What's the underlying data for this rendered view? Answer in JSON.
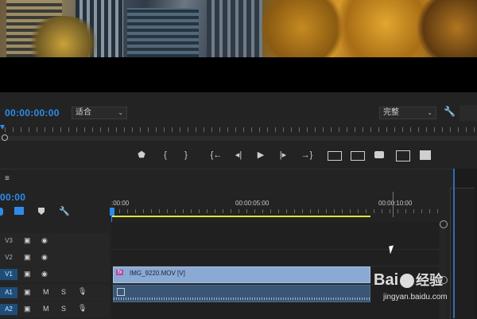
{
  "program_monitor": {
    "timecode": "00:00:00:00",
    "zoom_select": "适合",
    "quality_select": "完整"
  },
  "controls": {
    "marker": "⬟",
    "in_point": "{",
    "out_point": "}",
    "go_in": "{←",
    "step_back": "◂|",
    "play": "▶",
    "step_fwd": "|▸",
    "go_out": "→}"
  },
  "timeline": {
    "menu": "≡",
    "timecode": "00:00",
    "ruler_labels": [
      ":00:00",
      "00:00:05:00",
      "00:00:10:00"
    ],
    "tracks": [
      {
        "name": "V3",
        "active": false
      },
      {
        "name": "V2",
        "active": false
      },
      {
        "name": "V1",
        "active": true
      },
      {
        "name": "A1",
        "active": true
      },
      {
        "name": "A2",
        "active": true
      }
    ],
    "clip_video_label": "IMG_9220.MOV [V]",
    "fx_badge": "fx",
    "audio_m": "M",
    "audio_s": "S"
  },
  "watermark": {
    "brand": "Bai",
    "brand2": "经验",
    "url": "jingyan.baidu.com"
  },
  "colors": {
    "accent_blue": "#2d8ceb",
    "work_area_yellow": "#e2e23a",
    "video_clip": "#8aa9d3",
    "audio_clip": "#3b5675"
  }
}
